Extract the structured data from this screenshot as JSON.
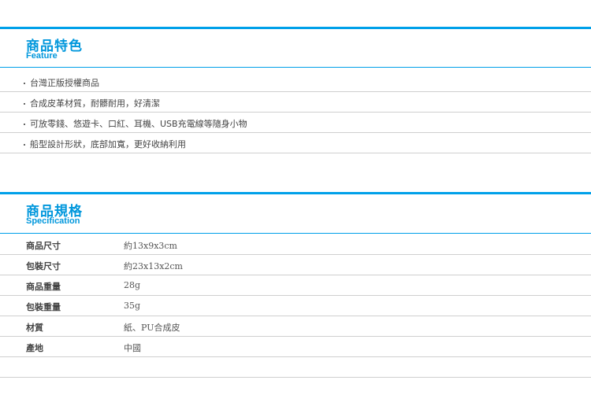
{
  "feature": {
    "title_zh": "商品特色",
    "title_en": "Feature",
    "items": [
      "台灣正版授權商品",
      "合成皮革材質，耐髒耐用，好清潔",
      "可放零錢、悠遊卡、口紅、耳機、USB充電線等隨身小物",
      "船型設計形狀，底部加寬，更好收納利用"
    ]
  },
  "specification": {
    "title_zh": "商品規格",
    "title_en": "Specification",
    "rows": [
      {
        "label": "商品尺寸",
        "value": "約13x9x3cm"
      },
      {
        "label": "包裝尺寸",
        "value": "約23x13x2cm"
      },
      {
        "label": "商品重量",
        "value": "28g"
      },
      {
        "label": "包裝重量",
        "value": "35g"
      },
      {
        "label": "材質",
        "value": "紙、PU合成皮"
      },
      {
        "label": "產地",
        "value": "中國"
      },
      {
        "label": "",
        "value": ""
      }
    ]
  },
  "colors": {
    "accent": "#00a0e9",
    "divider": "#cfcfcf"
  }
}
